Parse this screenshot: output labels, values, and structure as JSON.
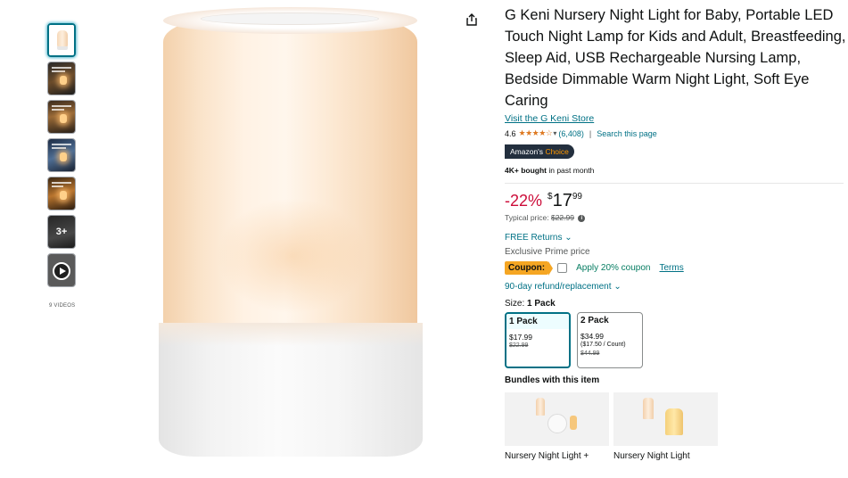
{
  "thumbnails": {
    "items": [
      {
        "name": "thumb-lamp",
        "kind": "lamp"
      },
      {
        "name": "thumb-scene-1",
        "kind": "dark1"
      },
      {
        "name": "thumb-scene-2",
        "kind": "dark2"
      },
      {
        "name": "thumb-scene-3",
        "kind": "dark3"
      },
      {
        "name": "thumb-scene-4",
        "kind": "dark4"
      },
      {
        "name": "thumb-more",
        "kind": "more",
        "label": "3+"
      },
      {
        "name": "thumb-video",
        "kind": "video"
      }
    ],
    "video_count_label": "9 VIDEOS"
  },
  "product": {
    "title": "G Keni Nursery Night Light for Baby, Portable LED Touch Night Lamp for Kids and Adult, Breastfeeding, Sleep Aid, USB Rechargeable Nursing Lamp, Bedside Dimmable Warm Night Light, Soft Eye Caring",
    "store_link": "Visit the G Keni Store",
    "rating": "4.6",
    "stars": "★★★★☆",
    "rating_count": "(6,408)",
    "search_page": "Search this page",
    "badge_prefix": "Amazon's",
    "badge_suffix": "Choice",
    "bought_bold": "4K+ bought",
    "bought_rest": " in past month"
  },
  "price": {
    "discount": "-22%",
    "currency": "$",
    "whole": "17",
    "fraction": "99",
    "typical_label": "Typical price: ",
    "typical_value": "$22.99",
    "info_icon": "i"
  },
  "offers": {
    "free_returns": "FREE Returns",
    "prime_price": "Exclusive Prime price",
    "coupon_badge": "Coupon:",
    "coupon_text": "Apply 20% coupon",
    "coupon_terms": "Terms",
    "refund": "90-day refund/replacement"
  },
  "size": {
    "label": "Size: ",
    "selected": "1 Pack",
    "options": [
      {
        "name": "1 Pack",
        "price": "$17.99",
        "unit": "",
        "list": "$22.99"
      },
      {
        "name": "2 Pack",
        "price": "$34.99",
        "unit": "($17.50 / Count)",
        "list": "$44.99"
      }
    ]
  },
  "bundles": {
    "title": "Bundles with this item",
    "items": [
      {
        "name": "Nursery Night Light +"
      },
      {
        "name": "Nursery Night Light"
      }
    ]
  },
  "colors": {
    "link": "#007185",
    "deal": "#cc0c39",
    "star": "#de7921",
    "badge_bg": "#232f3e",
    "badge_accent": "#ff9900",
    "coupon_bg": "#f5a623"
  }
}
